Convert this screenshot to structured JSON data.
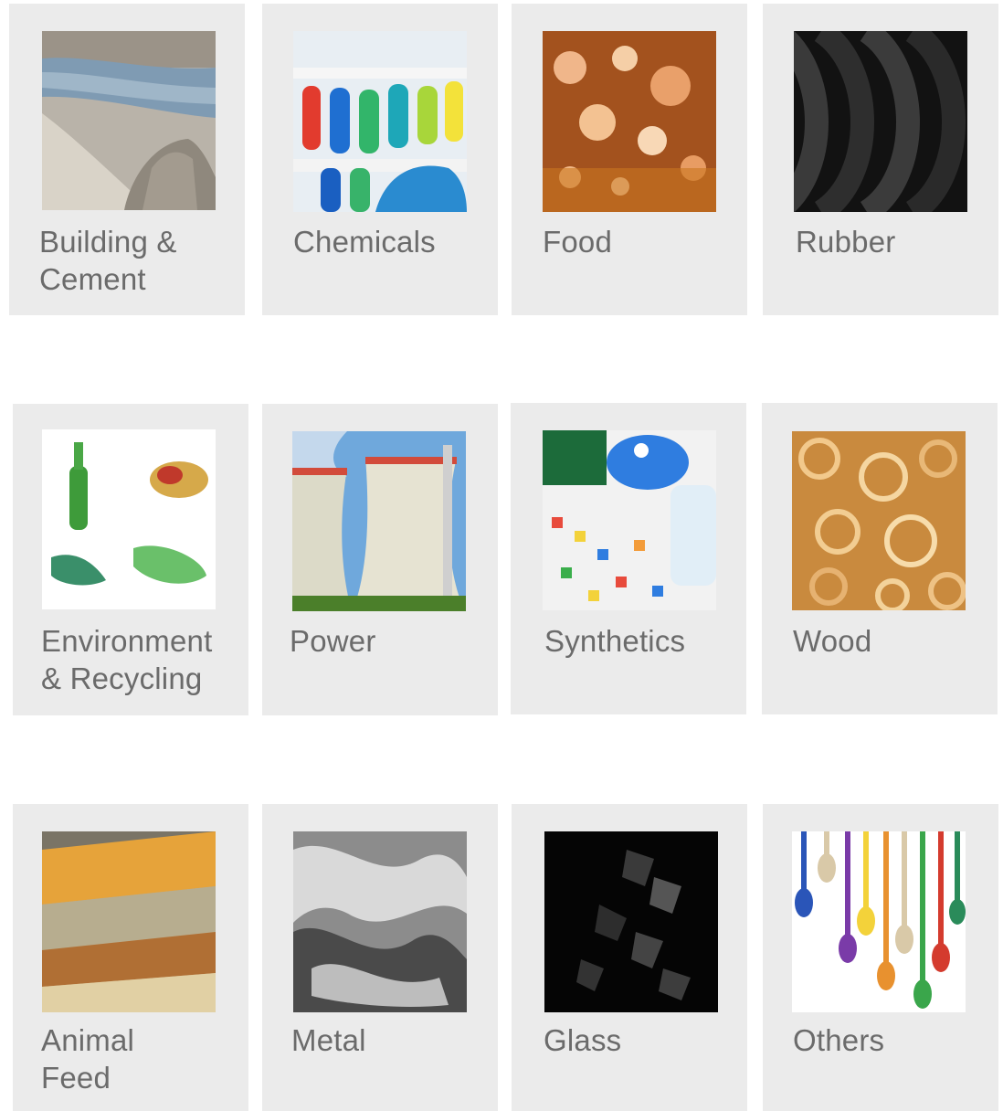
{
  "industries": [
    {
      "label": "Building & Cement",
      "image": "sand-pile-water-photo"
    },
    {
      "label": "Chemicals",
      "image": "test-tubes-photo"
    },
    {
      "label": "Food",
      "image": "bubbles-liquid-photo"
    },
    {
      "label": "Rubber",
      "image": "tires-stack-photo"
    },
    {
      "label": "Environment & Recycling",
      "image": "recyclables-photo"
    },
    {
      "label": "Power",
      "image": "cooling-towers-photo"
    },
    {
      "label": "Synthetics",
      "image": "plastic-granules-photo"
    },
    {
      "label": "Wood",
      "image": "wood-shavings-photo"
    },
    {
      "label": "Animal Feed",
      "image": "grains-seeds-photo"
    },
    {
      "label": "Metal",
      "image": "liquid-metal-photo"
    },
    {
      "label": "Glass",
      "image": "broken-glass-photo"
    },
    {
      "label": "Others",
      "image": "paint-drips-photo"
    }
  ]
}
